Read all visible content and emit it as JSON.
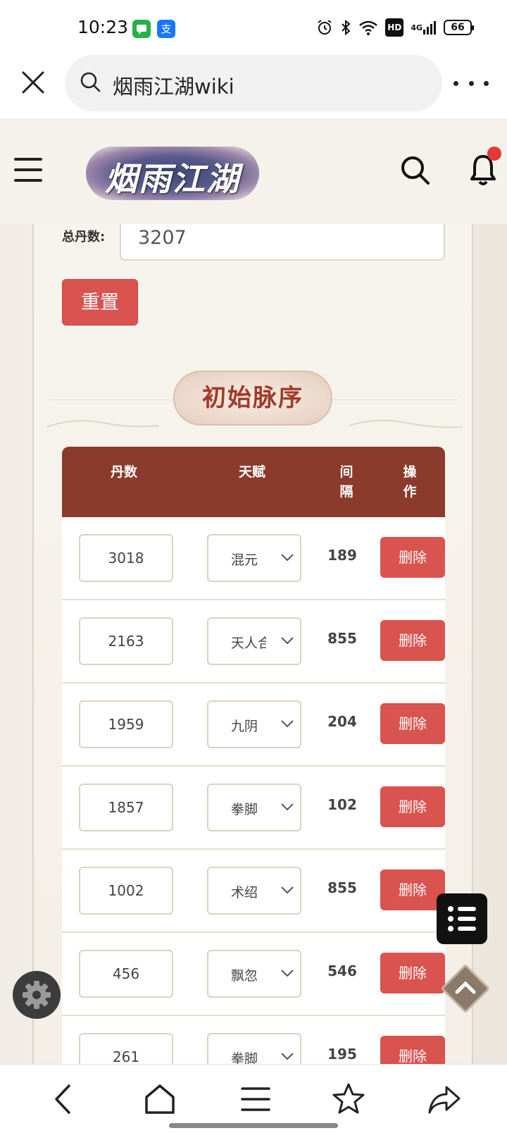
{
  "status_bar": {
    "time": "10:23",
    "app_icons": [
      "messages-icon",
      "alipay-icon"
    ],
    "alipay_glyph": "支",
    "hd_label": "HD",
    "network_label": "4G",
    "battery": "66"
  },
  "browser": {
    "url_text": "烟雨江湖wiki"
  },
  "site": {
    "logo_text": "烟雨江湖",
    "accent_color": "#8b3a2b",
    "danger_color": "#d9534f"
  },
  "form": {
    "total_label": "总丹数:",
    "total_value": "3207",
    "reset_label": "重置"
  },
  "section": {
    "title": "初始脉序"
  },
  "table": {
    "headers": {
      "dan": "丹数",
      "talent": "天赋",
      "gap": "间隔",
      "op": "操作"
    },
    "rows": [
      {
        "dan": "3018",
        "talent": "混元",
        "gap": "189",
        "action": "删除"
      },
      {
        "dan": "2163",
        "talent": "天人合一",
        "gap": "855",
        "action": "删除"
      },
      {
        "dan": "1959",
        "talent": "九阴",
        "gap": "204",
        "action": "删除"
      },
      {
        "dan": "1857",
        "talent": "拳脚",
        "gap": "102",
        "action": "删除"
      },
      {
        "dan": "1002",
        "talent": "术绍",
        "gap": "855",
        "action": "删除"
      },
      {
        "dan": "456",
        "talent": "飘忽",
        "gap": "546",
        "action": "删除"
      },
      {
        "dan": "261",
        "talent": "拳脚",
        "gap": "195",
        "action": "删除"
      }
    ]
  }
}
